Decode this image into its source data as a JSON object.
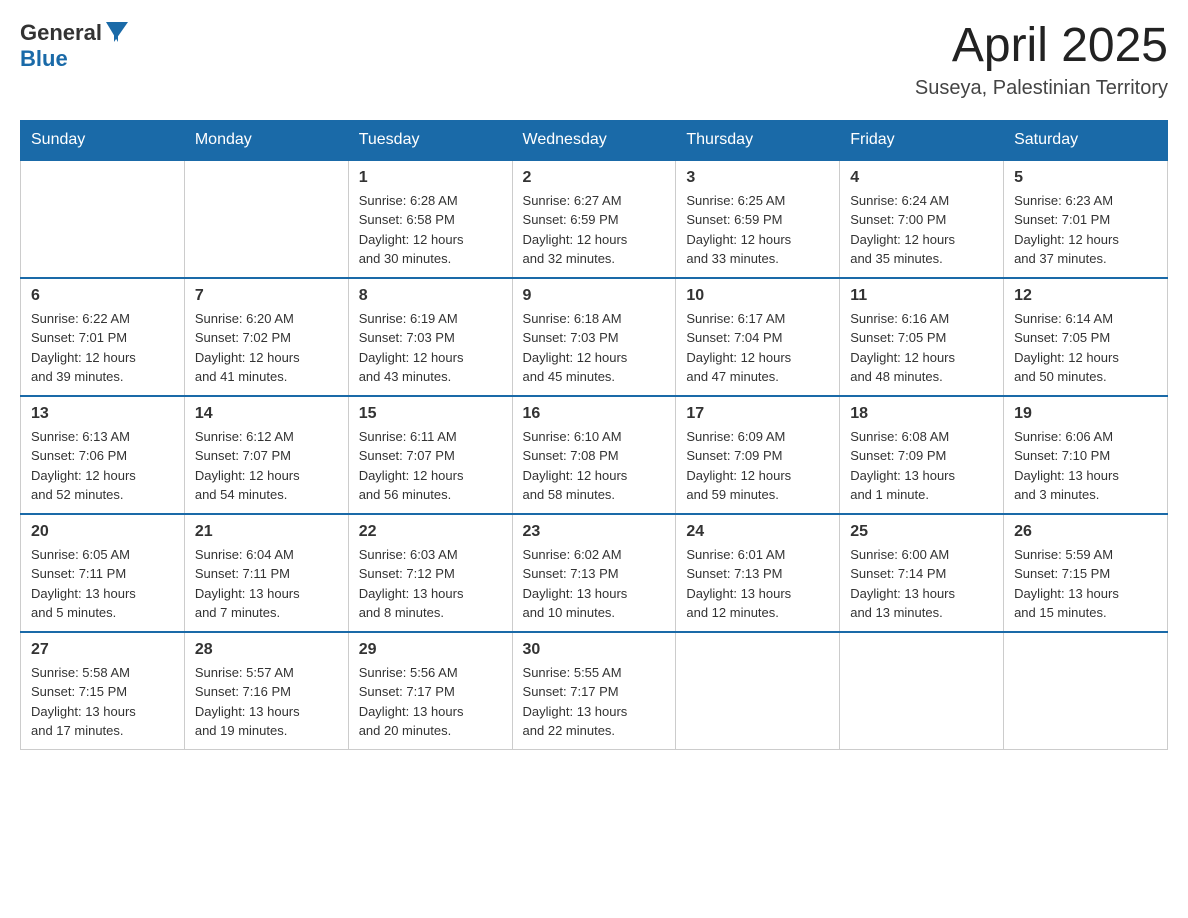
{
  "header": {
    "logo_text_general": "General",
    "logo_text_blue": "Blue",
    "month_title": "April 2025",
    "location": "Suseya, Palestinian Territory"
  },
  "calendar": {
    "days_of_week": [
      "Sunday",
      "Monday",
      "Tuesday",
      "Wednesday",
      "Thursday",
      "Friday",
      "Saturday"
    ],
    "weeks": [
      [
        {
          "day": "",
          "info": ""
        },
        {
          "day": "",
          "info": ""
        },
        {
          "day": "1",
          "info": "Sunrise: 6:28 AM\nSunset: 6:58 PM\nDaylight: 12 hours\nand 30 minutes."
        },
        {
          "day": "2",
          "info": "Sunrise: 6:27 AM\nSunset: 6:59 PM\nDaylight: 12 hours\nand 32 minutes."
        },
        {
          "day": "3",
          "info": "Sunrise: 6:25 AM\nSunset: 6:59 PM\nDaylight: 12 hours\nand 33 minutes."
        },
        {
          "day": "4",
          "info": "Sunrise: 6:24 AM\nSunset: 7:00 PM\nDaylight: 12 hours\nand 35 minutes."
        },
        {
          "day": "5",
          "info": "Sunrise: 6:23 AM\nSunset: 7:01 PM\nDaylight: 12 hours\nand 37 minutes."
        }
      ],
      [
        {
          "day": "6",
          "info": "Sunrise: 6:22 AM\nSunset: 7:01 PM\nDaylight: 12 hours\nand 39 minutes."
        },
        {
          "day": "7",
          "info": "Sunrise: 6:20 AM\nSunset: 7:02 PM\nDaylight: 12 hours\nand 41 minutes."
        },
        {
          "day": "8",
          "info": "Sunrise: 6:19 AM\nSunset: 7:03 PM\nDaylight: 12 hours\nand 43 minutes."
        },
        {
          "day": "9",
          "info": "Sunrise: 6:18 AM\nSunset: 7:03 PM\nDaylight: 12 hours\nand 45 minutes."
        },
        {
          "day": "10",
          "info": "Sunrise: 6:17 AM\nSunset: 7:04 PM\nDaylight: 12 hours\nand 47 minutes."
        },
        {
          "day": "11",
          "info": "Sunrise: 6:16 AM\nSunset: 7:05 PM\nDaylight: 12 hours\nand 48 minutes."
        },
        {
          "day": "12",
          "info": "Sunrise: 6:14 AM\nSunset: 7:05 PM\nDaylight: 12 hours\nand 50 minutes."
        }
      ],
      [
        {
          "day": "13",
          "info": "Sunrise: 6:13 AM\nSunset: 7:06 PM\nDaylight: 12 hours\nand 52 minutes."
        },
        {
          "day": "14",
          "info": "Sunrise: 6:12 AM\nSunset: 7:07 PM\nDaylight: 12 hours\nand 54 minutes."
        },
        {
          "day": "15",
          "info": "Sunrise: 6:11 AM\nSunset: 7:07 PM\nDaylight: 12 hours\nand 56 minutes."
        },
        {
          "day": "16",
          "info": "Sunrise: 6:10 AM\nSunset: 7:08 PM\nDaylight: 12 hours\nand 58 minutes."
        },
        {
          "day": "17",
          "info": "Sunrise: 6:09 AM\nSunset: 7:09 PM\nDaylight: 12 hours\nand 59 minutes."
        },
        {
          "day": "18",
          "info": "Sunrise: 6:08 AM\nSunset: 7:09 PM\nDaylight: 13 hours\nand 1 minute."
        },
        {
          "day": "19",
          "info": "Sunrise: 6:06 AM\nSunset: 7:10 PM\nDaylight: 13 hours\nand 3 minutes."
        }
      ],
      [
        {
          "day": "20",
          "info": "Sunrise: 6:05 AM\nSunset: 7:11 PM\nDaylight: 13 hours\nand 5 minutes."
        },
        {
          "day": "21",
          "info": "Sunrise: 6:04 AM\nSunset: 7:11 PM\nDaylight: 13 hours\nand 7 minutes."
        },
        {
          "day": "22",
          "info": "Sunrise: 6:03 AM\nSunset: 7:12 PM\nDaylight: 13 hours\nand 8 minutes."
        },
        {
          "day": "23",
          "info": "Sunrise: 6:02 AM\nSunset: 7:13 PM\nDaylight: 13 hours\nand 10 minutes."
        },
        {
          "day": "24",
          "info": "Sunrise: 6:01 AM\nSunset: 7:13 PM\nDaylight: 13 hours\nand 12 minutes."
        },
        {
          "day": "25",
          "info": "Sunrise: 6:00 AM\nSunset: 7:14 PM\nDaylight: 13 hours\nand 13 minutes."
        },
        {
          "day": "26",
          "info": "Sunrise: 5:59 AM\nSunset: 7:15 PM\nDaylight: 13 hours\nand 15 minutes."
        }
      ],
      [
        {
          "day": "27",
          "info": "Sunrise: 5:58 AM\nSunset: 7:15 PM\nDaylight: 13 hours\nand 17 minutes."
        },
        {
          "day": "28",
          "info": "Sunrise: 5:57 AM\nSunset: 7:16 PM\nDaylight: 13 hours\nand 19 minutes."
        },
        {
          "day": "29",
          "info": "Sunrise: 5:56 AM\nSunset: 7:17 PM\nDaylight: 13 hours\nand 20 minutes."
        },
        {
          "day": "30",
          "info": "Sunrise: 5:55 AM\nSunset: 7:17 PM\nDaylight: 13 hours\nand 22 minutes."
        },
        {
          "day": "",
          "info": ""
        },
        {
          "day": "",
          "info": ""
        },
        {
          "day": "",
          "info": ""
        }
      ]
    ]
  }
}
